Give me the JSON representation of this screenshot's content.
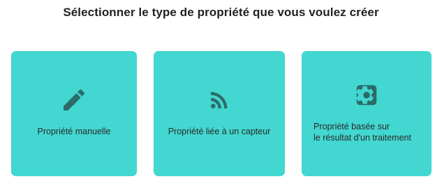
{
  "header": {
    "title": "Sélectionner le type de propriété que vous voulez créer"
  },
  "cards": [
    {
      "icon": "pencil-icon",
      "label": "Propriété manuelle"
    },
    {
      "icon": "rss-feed-icon",
      "label": "Propriété liée à un capteur"
    },
    {
      "icon": "gear-icon",
      "label_line1": "Propriété basée sur",
      "label_line2": "le résultat d'un traitement"
    }
  ],
  "colors": {
    "card_bg": "#42d7d0",
    "icon": "#2c6b68",
    "text": "#2a2a2a"
  }
}
